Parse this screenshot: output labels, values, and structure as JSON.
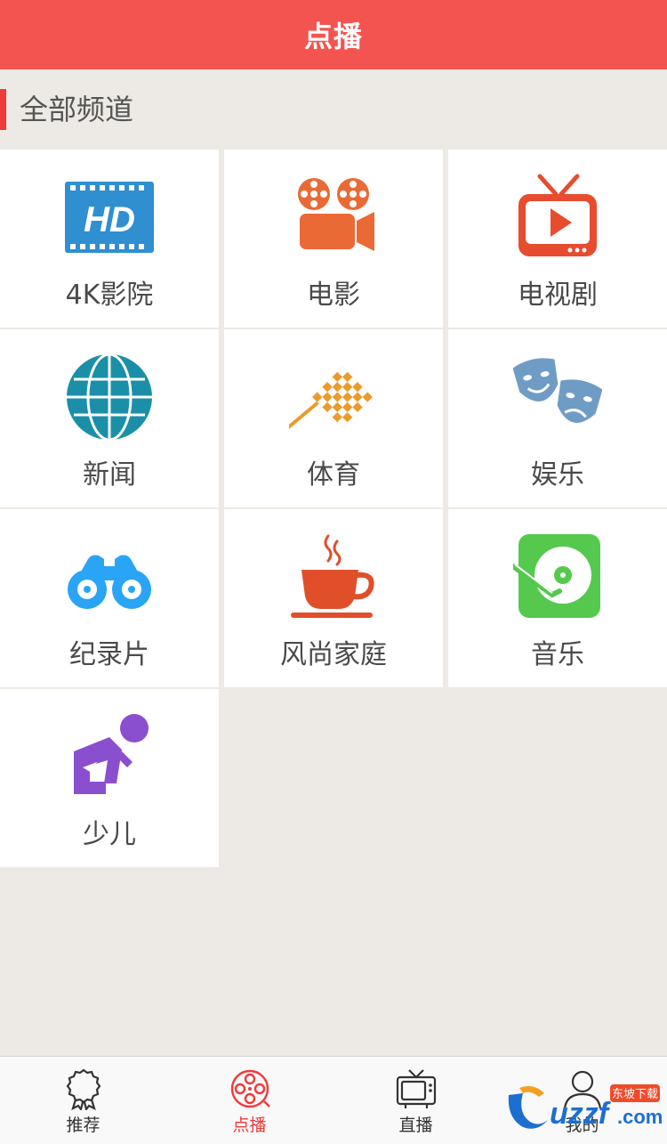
{
  "header": {
    "title": "点播"
  },
  "section": {
    "title": "全部频道"
  },
  "channels": [
    {
      "label": "4K影院",
      "icon": "hd-icon"
    },
    {
      "label": "电影",
      "icon": "movie-camera-icon"
    },
    {
      "label": "电视剧",
      "icon": "tv-play-icon"
    },
    {
      "label": "新闻",
      "icon": "globe-icon"
    },
    {
      "label": "体育",
      "icon": "checkered-flag-icon"
    },
    {
      "label": "娱乐",
      "icon": "theater-masks-icon"
    },
    {
      "label": "纪录片",
      "icon": "binoculars-icon"
    },
    {
      "label": "风尚家庭",
      "icon": "coffee-cup-icon"
    },
    {
      "label": "音乐",
      "icon": "turntable-icon"
    },
    {
      "label": "少儿",
      "icon": "crawling-child-icon"
    }
  ],
  "tabs": [
    {
      "label": "推荐",
      "icon": "award-ribbon-icon",
      "active": false
    },
    {
      "label": "点播",
      "icon": "film-reel-icon",
      "active": true
    },
    {
      "label": "直播",
      "icon": "tv-icon",
      "active": false
    },
    {
      "label": "我的",
      "icon": "user-icon",
      "active": false
    }
  ],
  "colors": {
    "header_bg": "#f35450",
    "accent": "#f03a3a",
    "page_bg": "#ede9e4",
    "tile_bg": "#ffffff"
  }
}
